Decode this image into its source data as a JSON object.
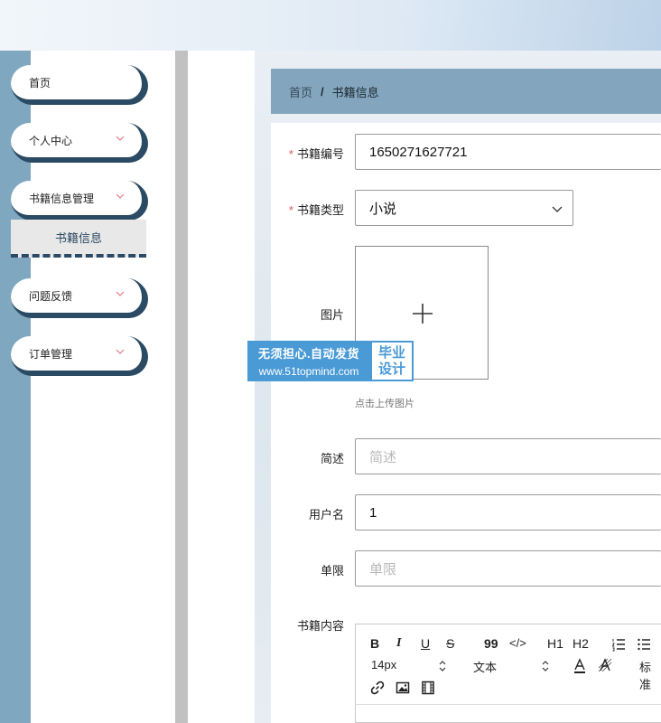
{
  "sidebar": {
    "items": [
      {
        "label": "首页",
        "has_chevron": false
      },
      {
        "label": "个人中心",
        "has_chevron": true
      },
      {
        "label": "书籍信息管理",
        "has_chevron": true
      },
      {
        "label": "问题反馈",
        "has_chevron": true
      },
      {
        "label": "订单管理",
        "has_chevron": true
      }
    ],
    "submenu_active": "书籍信息",
    "chevron_color": "#e07a8a",
    "accent": "#2b4a63"
  },
  "breadcrumb": {
    "home": "首页",
    "separator": "/",
    "current": "书籍信息"
  },
  "form": {
    "book_no": {
      "label": "书籍编号",
      "value": "1650271627721",
      "required": true
    },
    "book_type": {
      "label": "书籍类型",
      "value": "小说",
      "required": true
    },
    "image": {
      "label": "图片",
      "hint": "点击上传图片"
    },
    "summary": {
      "label": "简述",
      "placeholder": "简述",
      "value": ""
    },
    "username": {
      "label": "用户名",
      "value": "1"
    },
    "limit": {
      "label": "单限",
      "placeholder": "单限",
      "value": ""
    },
    "content": {
      "label": "书籍内容"
    }
  },
  "required_mark": "*",
  "editor": {
    "toolbar1": [
      "B",
      "I",
      "U",
      "S",
      "99",
      "</>",
      "H1",
      "H2"
    ],
    "font_size": "14px",
    "text_style": "文本",
    "normal_label": "标准"
  },
  "watermark": {
    "line1": "无须担心.自动发货",
    "line2": "www.51topmind.com",
    "badge_line1": "毕业",
    "badge_line2": "设计",
    "color": "#4a9ad6"
  }
}
